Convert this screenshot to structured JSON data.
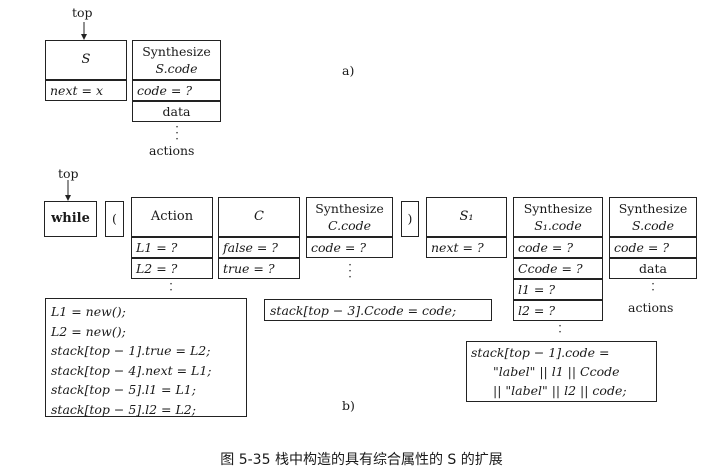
{
  "part_a": {
    "top_label": "top",
    "s_cell": "S",
    "next_cell": "next = x",
    "synth_line1": "Synthesize",
    "synth_line2": "S.code",
    "code_cell": "code = ?",
    "data_cell": "data",
    "actions_label": "actions",
    "panel_label": "a)"
  },
  "part_b": {
    "top_label": "top",
    "while_cell": "while",
    "lparen_cell": "(",
    "action_cell": "Action",
    "l1_cell": "L1 = ?",
    "l2_cell": "L2 = ?",
    "c_cell": "C",
    "false_cell": "false = ?",
    "true_cell": "true = ?",
    "synth_c_line1": "Synthesize",
    "synth_c_line2": "C.code",
    "synth_c_code": "code = ?",
    "rparen_cell": ")",
    "s1_cell": "S₁",
    "s1_next": "next = ?",
    "synth_s1_line1": "Synthesize",
    "synth_s1_line2": "S₁.code",
    "synth_s1_code": "code = ?",
    "synth_s1_ccode": "Ccode = ?",
    "synth_s1_l1": "l1 = ?",
    "synth_s1_l2": "l2 = ?",
    "synth_s_line1": "Synthesize",
    "synth_s_line2": "S.code",
    "synth_s_code": "code = ?",
    "synth_s_data": "data",
    "actions_label": "actions",
    "action_code": [
      "L1 = new();",
      "L2 = new();",
      "stack[top − 1].true = L2;",
      "stack[top − 4].next = L1;",
      "stack[top − 5].l1 = L1;",
      "stack[top − 5].l2 = L2;"
    ],
    "ccode_assign": "stack[top − 3].Ccode = code;",
    "final_code": [
      "stack[top − 1].code  =",
      "\"label\" || l1 || Ccode",
      "|| \"label\" || l2 || code;"
    ],
    "panel_label": "b)"
  },
  "caption": "图 5-35    栈中构造的具有综合属性的 S 的扩展"
}
